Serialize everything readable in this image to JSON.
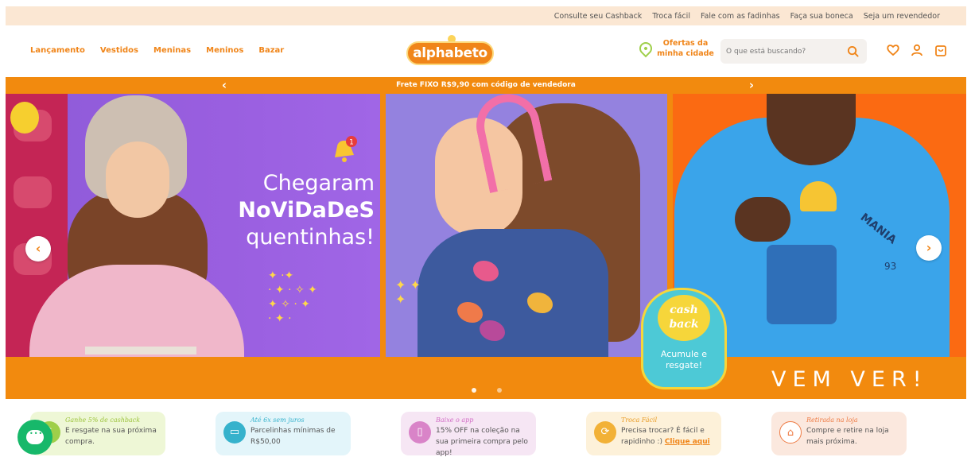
{
  "topbar": {
    "links": [
      "Consulte seu Cashback",
      "Troca fácil",
      "Fale com as fadinhas",
      "Faça sua boneca",
      "Seja um revendedor"
    ]
  },
  "header": {
    "nav": [
      "Lançamento",
      "Vestidos",
      "Meninas",
      "Meninos",
      "Bazar"
    ],
    "logo_text": "alphabeto",
    "offers_label": "Ofertas da minha cidade",
    "search_placeholder": "O que está buscando?",
    "icons": [
      "search-icon",
      "heart-icon",
      "user-icon",
      "bag-icon"
    ]
  },
  "promo": {
    "text": "Frete FIXO R$9,90 com código de vendedora",
    "prev": "‹",
    "next": "›"
  },
  "hero": {
    "headline_1": "Chegaram",
    "headline_2": "NoViDaDeS",
    "headline_3": "quentinhas!",
    "notification_count": "1",
    "shirt_text_1": "MANIA",
    "shirt_text_2": "93",
    "cta": "VEM VER!",
    "cashback_title_1": "cash",
    "cashback_title_2": "back",
    "cashback_sub": "Acumule e resgate!",
    "prev": "‹",
    "next": "›",
    "dots": 2,
    "active_dot": 2
  },
  "benefits": [
    {
      "title": "Ganhe 5% de cashback",
      "desc": "E resgate na sua próxima compra.",
      "icon": "cashback-icon"
    },
    {
      "title": "Até 6x sem juros",
      "desc": "Parcelinhas mínimas de R$50,00",
      "icon": "card-icon"
    },
    {
      "title": "Baixe o app",
      "desc": "15% OFF na coleção na sua primeira compra pelo app!",
      "icon": "phone-icon"
    },
    {
      "title": "Troca Fácil",
      "desc": "Precisa trocar? É fácil e rapidinho :) ",
      "link": "Clique aqui",
      "icon": "exchange-icon"
    },
    {
      "title": "Retirada na loja",
      "desc": "Compre e retire na loja mais próxima.",
      "icon": "store-icon"
    }
  ],
  "colors": {
    "brand_orange": "#f08519",
    "promo_bar": "#f28a0e",
    "topbar_bg": "#fbe7d3",
    "chat_green": "#17b86a"
  }
}
